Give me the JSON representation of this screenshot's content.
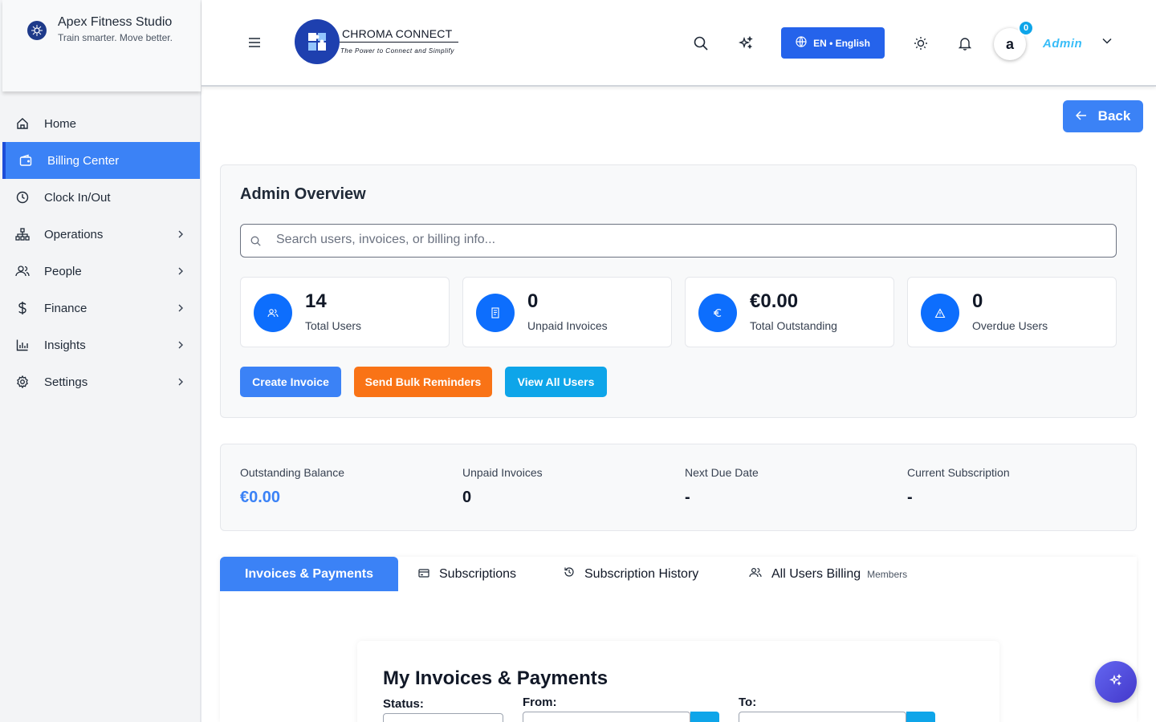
{
  "brand": {
    "name": "Apex Fitness Studio",
    "tagline": "Train smarter. Move better."
  },
  "sidebar": {
    "items": [
      {
        "label": "Home",
        "icon": "home-icon"
      },
      {
        "label": "Billing Center",
        "icon": "wallet-icon",
        "active": true
      },
      {
        "label": "Clock In/Out",
        "icon": "clock-icon"
      },
      {
        "label": "Operations",
        "icon": "sitemap-icon"
      },
      {
        "label": "People",
        "icon": "users-icon"
      },
      {
        "label": "Finance",
        "icon": "dollar-icon"
      },
      {
        "label": "Insights",
        "icon": "bar-chart-icon"
      },
      {
        "label": "Settings",
        "icon": "gear-icon"
      }
    ]
  },
  "topbar": {
    "logo_title": "CHROMA CONNECT",
    "logo_subtitle": "The Power to Connect and Simplify",
    "language_label": "EN • English",
    "avatar_letter": "a",
    "notification_count": "0",
    "user_name": "Admin"
  },
  "back_label": "Back",
  "overview": {
    "title": "Admin Overview",
    "search_placeholder": "Search users, invoices, or billing info...",
    "stats": [
      {
        "value": "14",
        "label": "Total Users",
        "icon": "users-icon"
      },
      {
        "value": "0",
        "label": "Unpaid Invoices",
        "icon": "receipt-icon"
      },
      {
        "value": "€0.00",
        "label": "Total Outstanding",
        "icon": "euro-icon"
      },
      {
        "value": "0",
        "label": "Overdue Users",
        "icon": "warning-icon"
      }
    ],
    "actions": {
      "create_invoice": "Create Invoice",
      "send_reminders": "Send Bulk Reminders",
      "view_users": "View All Users"
    }
  },
  "summary": {
    "outstanding_label": "Outstanding Balance",
    "outstanding_value": "€0.00",
    "unpaid_label": "Unpaid Invoices",
    "unpaid_value": "0",
    "due_label": "Next Due Date",
    "due_value": "-",
    "subscription_label": "Current Subscription",
    "subscription_value": "-"
  },
  "tabs": {
    "invoices": "Invoices & Payments",
    "subscriptions": "Subscriptions",
    "history": "Subscription History",
    "all_users": "All Users Billing",
    "all_users_badge": "Members"
  },
  "invoices_section": {
    "title": "My Invoices & Payments",
    "status_label": "Status:",
    "from_label": "From:",
    "to_label": "To:"
  },
  "colors": {
    "primary": "#3b82f6",
    "stat_icon": "#0d6efd",
    "orange": "#f97316",
    "cyan": "#0ea5e9"
  }
}
